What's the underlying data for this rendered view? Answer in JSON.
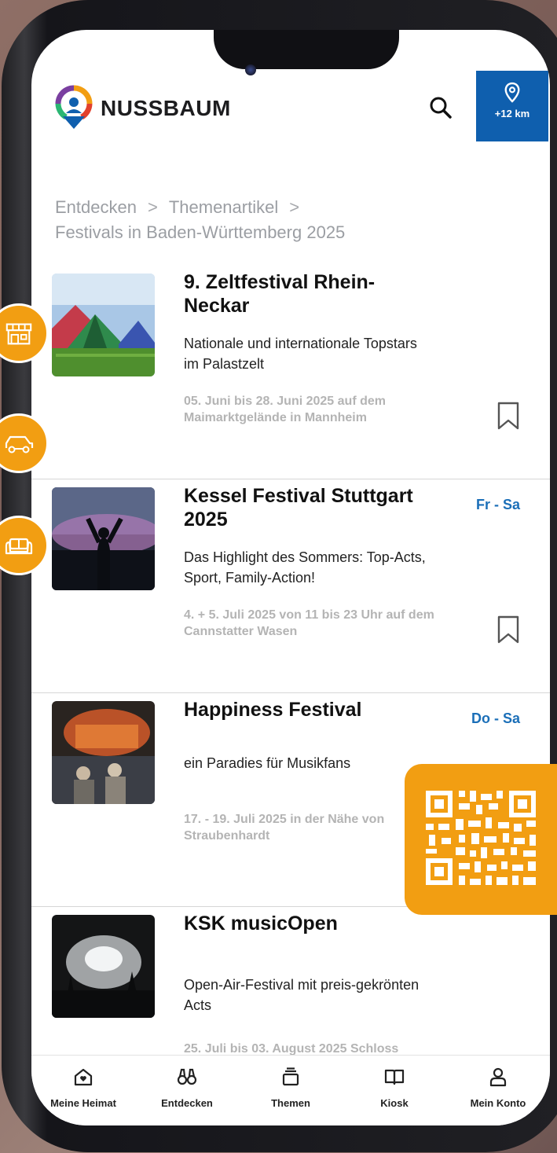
{
  "brand": {
    "name": "NUSSBAUM"
  },
  "header": {
    "search_icon": "search-icon",
    "location": {
      "icon": "map-pin-icon",
      "label": "+12 km"
    }
  },
  "breadcrumb": {
    "items": [
      "Entdecken",
      "Themenartikel",
      "Festivals in Baden-Württemberg 2025"
    ],
    "separator": ">"
  },
  "articles": [
    {
      "title": "9. Zeltfestival Rhein-Neckar",
      "days": "",
      "description": "Nationale und internationale Topstars im Palastzelt",
      "meta": "05. Juni bis 28. Juni 2025 auf dem Maimarktgelände in Mannheim",
      "bookmarked": false
    },
    {
      "title": "Kessel Festival Stuttgart 2025",
      "days": "Fr - Sa",
      "description": "Das Highlight des Sommers: Top-Acts, Sport, Family-Action!",
      "meta": "4. + 5. Juli 2025 von 11 bis 23 Uhr auf dem Cannstatter Wasen",
      "bookmarked": false
    },
    {
      "title": "Happiness Festival",
      "days": "Do - Sa",
      "description": "ein Paradies für Musikfans",
      "meta": "17. - 19. Juli 2025 in der Nähe von Straubenhardt",
      "bookmarked": false
    },
    {
      "title": "KSK musicOpen",
      "days": "",
      "description": "Open-Air-Festival mit preis-gekrönten Acts",
      "meta": "25. Juli bis 03. August 2025 Schloss",
      "bookmarked": false
    }
  ],
  "tabbar": [
    {
      "label": "Meine Heimat",
      "icon": "home-heart-icon"
    },
    {
      "label": "Entdecken",
      "icon": "binoculars-icon"
    },
    {
      "label": "Themen",
      "icon": "layers-icon"
    },
    {
      "label": "Kiosk",
      "icon": "book-icon"
    },
    {
      "label": "Mein Konto",
      "icon": "user-icon"
    }
  ],
  "colors": {
    "accent_blue": "#0f5fae",
    "day_blue": "#1b6fb8",
    "orange": "#f29e12",
    "muted_text": "#b4b4b4"
  }
}
